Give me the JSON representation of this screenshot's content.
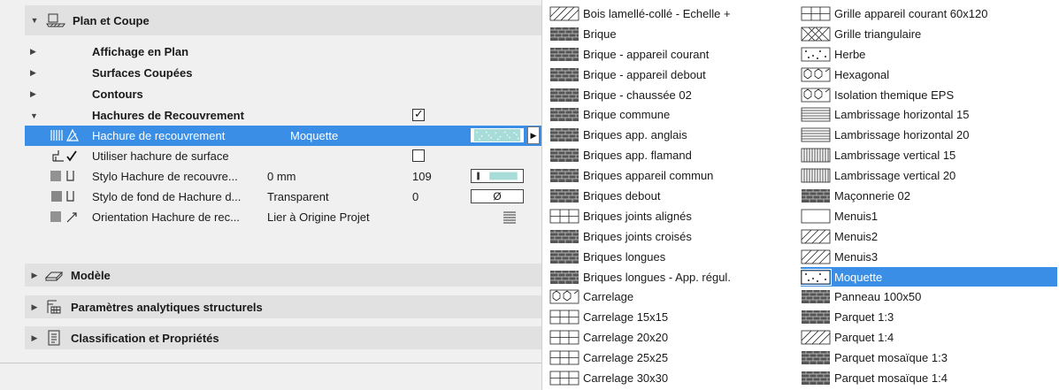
{
  "panel": {
    "section_title": "Plan et Coupe",
    "subsections": [
      {
        "label": "Affichage en Plan"
      },
      {
        "label": "Surfaces Coupées"
      },
      {
        "label": "Contours"
      },
      {
        "label": "Hachures de Recouvrement",
        "checked": true
      }
    ],
    "rows": [
      {
        "name": "Hachure de recouvrement",
        "value": "Moquette",
        "selected": true,
        "icon": "fill-hatch-icon"
      },
      {
        "name": "Utiliser hachure de surface",
        "value": "",
        "checkbox": false,
        "icon": "surface-fill-icon"
      },
      {
        "name": "Stylo Hachure de recouvre...",
        "value": "0 mm",
        "number": "109",
        "icon": "pen-icon"
      },
      {
        "name": "Stylo de fond de Hachure d...",
        "value": "Transparent",
        "number": "0",
        "swatch_text": "Ø",
        "icon": "background-pen-icon"
      },
      {
        "name": "Orientation Hachure de rec...",
        "value": "Lier à Origine Projet",
        "icon": "orientation-icon"
      }
    ],
    "other_sections": [
      {
        "label": "Modèle",
        "icon": "model-icon"
      },
      {
        "label": "Paramètres analytiques structurels",
        "icon": "structural-icon"
      },
      {
        "label": "Classification et Propriétés",
        "icon": "classification-icon"
      }
    ]
  },
  "dropdown": {
    "column1": [
      "Bois lamellé-collé - Echelle +",
      "Brique",
      "Brique - appareil courant",
      "Brique - appareil debout",
      "Brique - chaussée 02",
      "Brique commune",
      "Briques app. anglais",
      "Briques app. flamand",
      "Briques appareil commun",
      "Briques debout",
      "Briques joints alignés",
      "Briques joints croisés",
      "Briques longues",
      "Briques longues - App. régul.",
      "Carrelage",
      "Carrelage 15x15",
      "Carrelage 20x20",
      "Carrelage 25x25",
      "Carrelage 30x30"
    ],
    "column2": [
      "Grille appareil courant 60x120",
      "Grille triangulaire",
      "Herbe",
      "Hexagonal",
      "Isolation themique EPS",
      "Lambrissage horizontal 15",
      "Lambrissage horizontal 20",
      "Lambrissage vertical 15",
      "Lambrissage vertical 20",
      "Maçonnerie 02",
      "Menuis1",
      "Menuis2",
      "Menuis3",
      "Moquette",
      "Panneau 100x50",
      "Parquet 1:3",
      "Parquet 1:4",
      "Parquet mosaïque 1:3",
      "Parquet mosaïque 1:4"
    ],
    "selected": "Moquette"
  },
  "colors": {
    "selection": "#3a8ee6",
    "section_bg": "#e1e1e1",
    "panel_bg": "#f0f0f0",
    "accent_swatch": "#a8dcd8"
  }
}
